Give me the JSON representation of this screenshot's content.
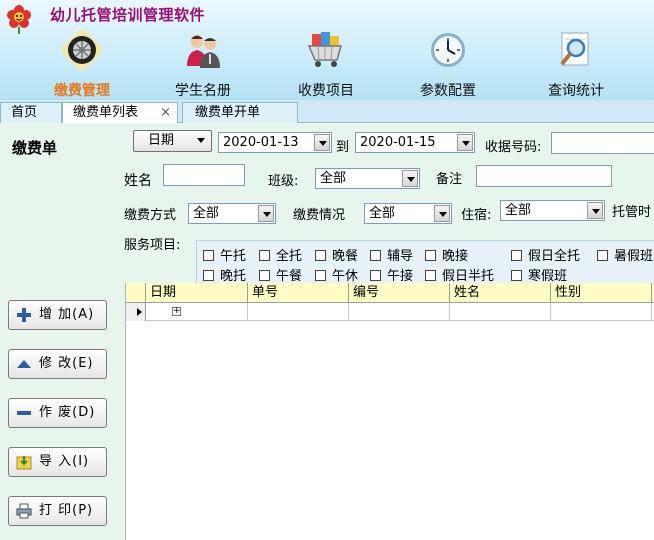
{
  "app": {
    "title": "幼儿托管培训管理软件"
  },
  "nav": [
    {
      "label": "缴费管理",
      "icon": "tire-icon",
      "active": true
    },
    {
      "label": "学生名册",
      "icon": "students-icon",
      "active": false
    },
    {
      "label": "收费项目",
      "icon": "cart-icon",
      "active": false
    },
    {
      "label": "参数配置",
      "icon": "clock-icon",
      "active": false
    },
    {
      "label": "查询统计",
      "icon": "magnifier-icon",
      "active": false
    }
  ],
  "tabs": [
    {
      "label": "首页"
    },
    {
      "label": "缴费单列表",
      "close": "×"
    },
    {
      "label": "缴费单开单"
    }
  ],
  "form": {
    "section_title": "缴费单",
    "date_button": "日期",
    "date_from": "2020-01-13",
    "to_label": "到",
    "date_to": "2020-01-15",
    "receipt_label": "收据号码:",
    "name_label": "姓名",
    "class_label": "班级:",
    "class_value": "全部",
    "remark_label": "备注",
    "pay_method_label": "缴费方式",
    "pay_method_value": "全部",
    "pay_status_label": "缴费情况",
    "pay_status_value": "全部",
    "boarding_label": "住宿:",
    "boarding_value": "全部",
    "custody_time_label": "托管时",
    "services_label": "服务项目:",
    "services_row1": [
      "午托",
      "全托",
      "晚餐",
      "辅导",
      "晚接",
      "假日全托",
      "暑假班"
    ],
    "services_row2": [
      "晚托",
      "午餐",
      "午休",
      "午接",
      "假日半托",
      "寒假班"
    ]
  },
  "actions": [
    {
      "label": "增 加(A)",
      "icon": "plus-icon"
    },
    {
      "label": "修 改(E)",
      "icon": "arrow-up-icon"
    },
    {
      "label": "作 废(D)",
      "icon": "minus-icon"
    },
    {
      "label": "导 入(I)",
      "icon": "import-icon"
    },
    {
      "label": "打 印(P)",
      "icon": "printer-icon"
    }
  ],
  "grid": {
    "columns": [
      "日期",
      "单号",
      "编号",
      "姓名",
      "性别"
    ],
    "expand": "+"
  },
  "colors": {
    "accent": "#e8761a",
    "title": "#9a1070",
    "header_bg": "#c9ecfa",
    "panel_bg": "#e6f6ec",
    "grid_header": "#fdfcc2"
  }
}
